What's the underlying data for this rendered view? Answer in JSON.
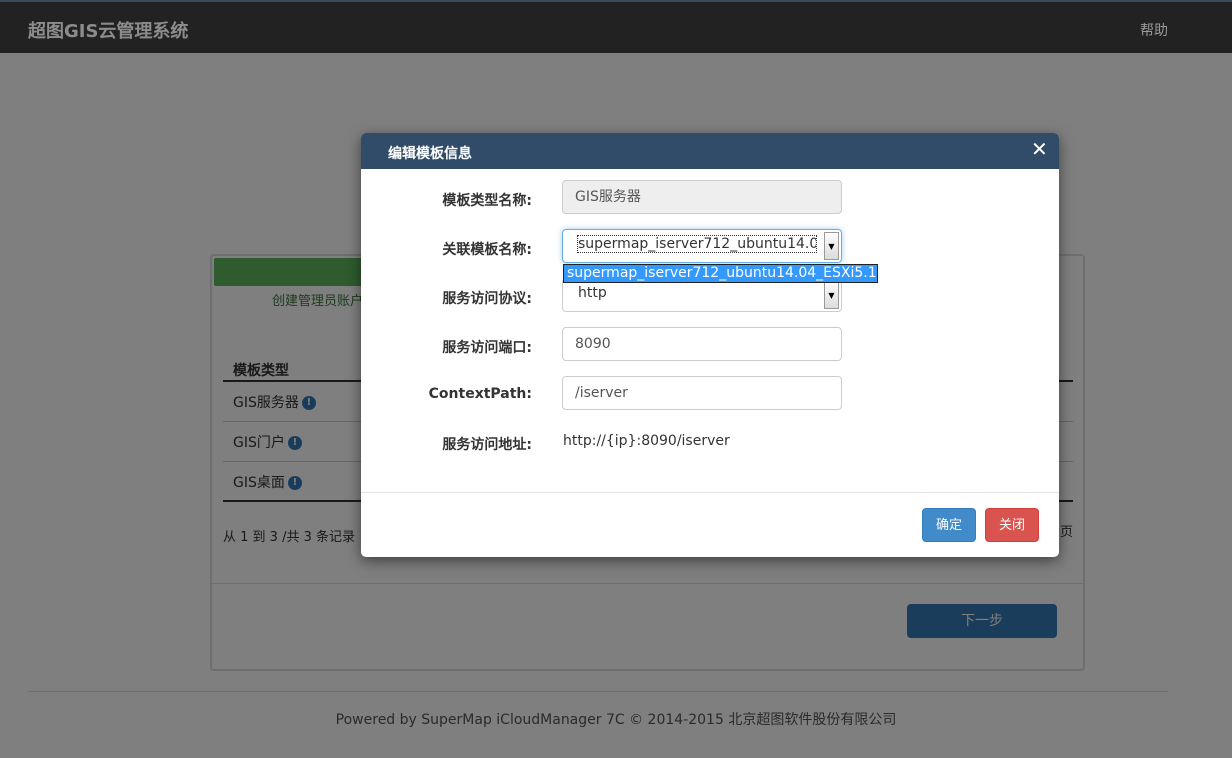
{
  "navbar": {
    "brand": "超图GIS云管理系统",
    "help": "帮助"
  },
  "background": {
    "step_label": "创建管理员账户",
    "table": {
      "header": "模板类型",
      "rows": [
        "GIS服务器",
        "GIS门户",
        "GIS桌面"
      ]
    },
    "pager_left": "从 1 到 3 /共 3 条记录",
    "pager_right": "页",
    "next_button": "下一步",
    "footer": "Powered by SuperMap iCloudManager 7C © 2014-2015 北京超图软件股份有限公司"
  },
  "modal": {
    "title": "编辑模板信息",
    "close_glyph": "✕",
    "fields": {
      "template_type": {
        "label": "模板类型名称:",
        "value": "GIS服务器"
      },
      "related_template": {
        "label": "关联模板名称:",
        "value": "supermap_iserver712_ubuntu14.04",
        "dropdown_option": "supermap_iserver712_ubuntu14.04_ESXi5.1"
      },
      "protocol": {
        "label": "服务访问协议:",
        "value": "http"
      },
      "port": {
        "label": "服务访问端口:",
        "value": "8090"
      },
      "context_path": {
        "label": "ContextPath:",
        "value": "/iserver"
      },
      "service_url": {
        "label": "服务访问地址:",
        "value": "http://{ip}:8090/iserver"
      }
    },
    "buttons": {
      "ok": "确定",
      "close": "关闭"
    }
  },
  "colors": {
    "header": "#304c68",
    "primary": "#428bca",
    "danger": "#d9534f",
    "success": "#5cb85c",
    "navbar": "#222222"
  },
  "icons": {
    "info": "info-circle-icon",
    "dropdown_arrow": "caret-down-icon",
    "close": "close-icon"
  }
}
